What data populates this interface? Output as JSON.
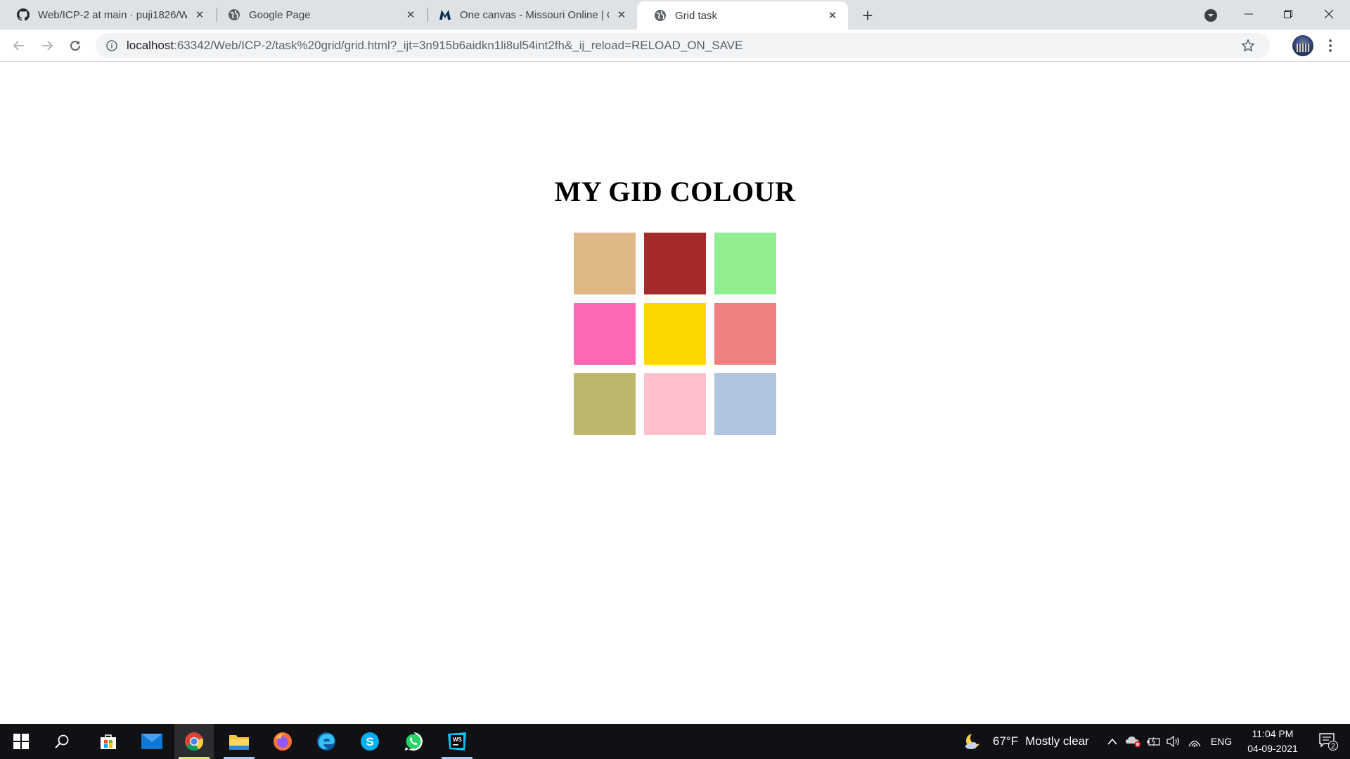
{
  "browser": {
    "tabs": [
      {
        "title": "Web/ICP-2 at main · puji1826/We",
        "icon": "github-icon",
        "active": false
      },
      {
        "title": "Google Page",
        "icon": "globe-icon",
        "active": false
      },
      {
        "title": "One canvas - Missouri Online | O",
        "icon": "missouri-m-icon",
        "active": false
      },
      {
        "title": "Grid task",
        "icon": "globe-icon",
        "active": true
      }
    ],
    "new_tab": "+",
    "url": {
      "host": "localhost",
      "rest": ":63342/Web/ICP-2/task%20grid/grid.html?_ijt=3n915b6aidkn1li8ul54int2fh&_ij_reload=RELOAD_ON_SAVE"
    }
  },
  "page": {
    "heading": "MY GID COLOUR",
    "grid_colors": [
      "#deb887",
      "#a52a2a",
      "#90ee90",
      "#ff69b4",
      "#ffd700",
      "#f08080",
      "#bdb76b",
      "#ffc0cb",
      "#b0c4de"
    ]
  },
  "taskbar": {
    "apps": [
      "windows-start-icon",
      "search-icon",
      "microsoft-store-icon",
      "mail-icon",
      "chrome-icon",
      "file-explorer-icon",
      "firefox-icon",
      "edge-icon",
      "skype-icon",
      "whatsapp-icon",
      "webstorm-icon"
    ],
    "weather": {
      "temp": "67°F",
      "condition": "Mostly clear"
    },
    "language": "ENG",
    "time": "11:04 PM",
    "date": "04-09-2021",
    "notification_count": "2"
  }
}
